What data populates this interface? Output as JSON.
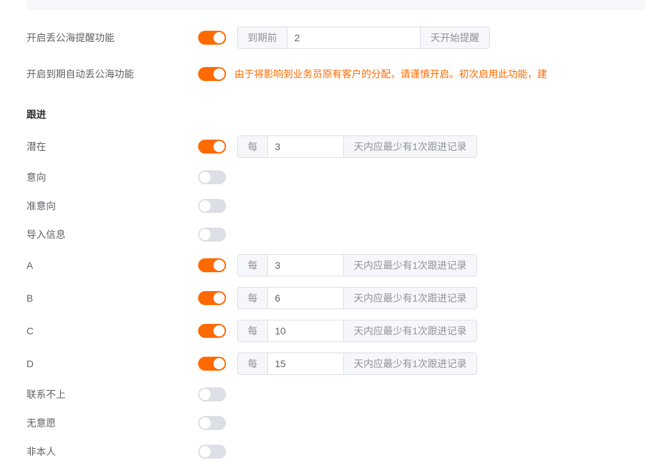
{
  "reminder": {
    "label": "开启丢公海提醒功能",
    "on": true,
    "prefix": "到期前",
    "value": "2",
    "suffix": "天开始提醒"
  },
  "autoDrop": {
    "label": "开启到期自动丢公海功能",
    "on": true,
    "warning": "由于将影响到业务员原有客户的分配，请谨慎开启。初次启用此功能，建"
  },
  "section": {
    "title": "跟进",
    "inputPrefix": "每",
    "inputSuffix": "天内应最少有1次跟进记录"
  },
  "followRows": [
    {
      "label": "潜在",
      "on": true,
      "value": "3"
    },
    {
      "label": "意向",
      "on": false,
      "value": ""
    },
    {
      "label": "准意向",
      "on": false,
      "value": ""
    },
    {
      "label": "导入信息",
      "on": false,
      "value": ""
    },
    {
      "label": "A",
      "on": true,
      "value": "3"
    },
    {
      "label": "B",
      "on": true,
      "value": "6"
    },
    {
      "label": "C",
      "on": true,
      "value": "10"
    },
    {
      "label": "D",
      "on": true,
      "value": "15"
    },
    {
      "label": "联系不上",
      "on": false,
      "value": ""
    },
    {
      "label": "无意愿",
      "on": false,
      "value": ""
    },
    {
      "label": "非本人",
      "on": false,
      "value": ""
    }
  ]
}
